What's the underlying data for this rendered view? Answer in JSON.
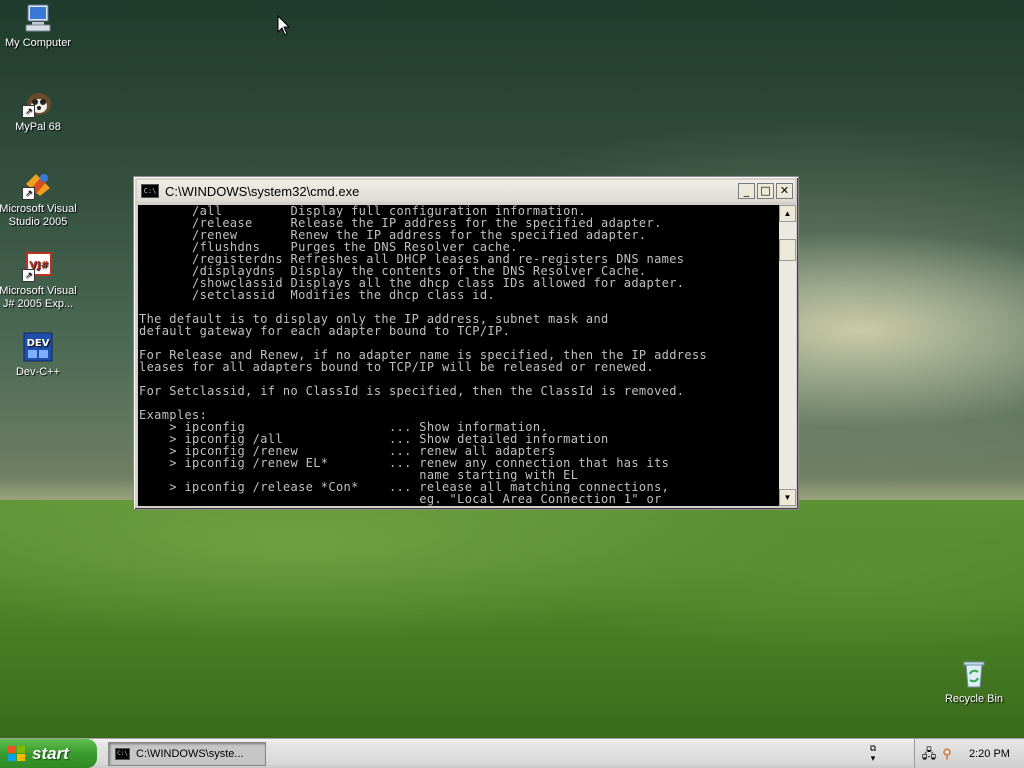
{
  "desktop": {
    "icons": [
      {
        "label": "My Computer",
        "icon": "computer-icon"
      },
      {
        "label": "MyPal 68",
        "icon": "mypal-icon"
      },
      {
        "label": "Microsoft Visual Studio 2005",
        "icon": "visual-studio-icon"
      },
      {
        "label": "Microsoft Visual J# 2005 Exp...",
        "icon": "visual-jsharp-icon"
      },
      {
        "label": "Dev-C++",
        "icon": "devcpp-icon"
      },
      {
        "label": "Recycle Bin",
        "icon": "recycle-bin-icon"
      }
    ],
    "devcpp_badge": "DEV",
    "jsharp_badge": "VJ#"
  },
  "cmd_window": {
    "title": "C:\\WINDOWS\\system32\\cmd.exe",
    "app_icon_text": "C:\\",
    "minimize": "_",
    "maximize": "□",
    "close": "✕",
    "scroll_up": "▲",
    "scroll_down": "▼",
    "console_lines": [
      "       /all         Display full configuration information.",
      "       /release     Release the IP address for the specified adapter.",
      "       /renew       Renew the IP address for the specified adapter.",
      "       /flushdns    Purges the DNS Resolver cache.",
      "       /registerdns Refreshes all DHCP leases and re-registers DNS names",
      "       /displaydns  Display the contents of the DNS Resolver Cache.",
      "       /showclassid Displays all the dhcp class IDs allowed for adapter.",
      "       /setclassid  Modifies the dhcp class id.",
      "",
      "The default is to display only the IP address, subnet mask and",
      "default gateway for each adapter bound to TCP/IP.",
      "",
      "For Release and Renew, if no adapter name is specified, then the IP address",
      "leases for all adapters bound to TCP/IP will be released or renewed.",
      "",
      "For Setclassid, if no ClassId is specified, then the ClassId is removed.",
      "",
      "Examples:",
      "    > ipconfig                   ... Show information.",
      "    > ipconfig /all              ... Show detailed information",
      "    > ipconfig /renew            ... renew all adapters",
      "    > ipconfig /renew EL*        ... renew any connection that has its",
      "                                     name starting with EL",
      "    > ipconfig /release *Con*    ... release all matching connections,",
      "                                     eg. \"Local Area Connection 1\" or"
    ]
  },
  "taskbar": {
    "start_label": "start",
    "task_button_label": "C:\\WINDOWS\\syste...",
    "clock": "2:20 PM",
    "colors": {
      "start_green": "#3a9c2e"
    }
  }
}
